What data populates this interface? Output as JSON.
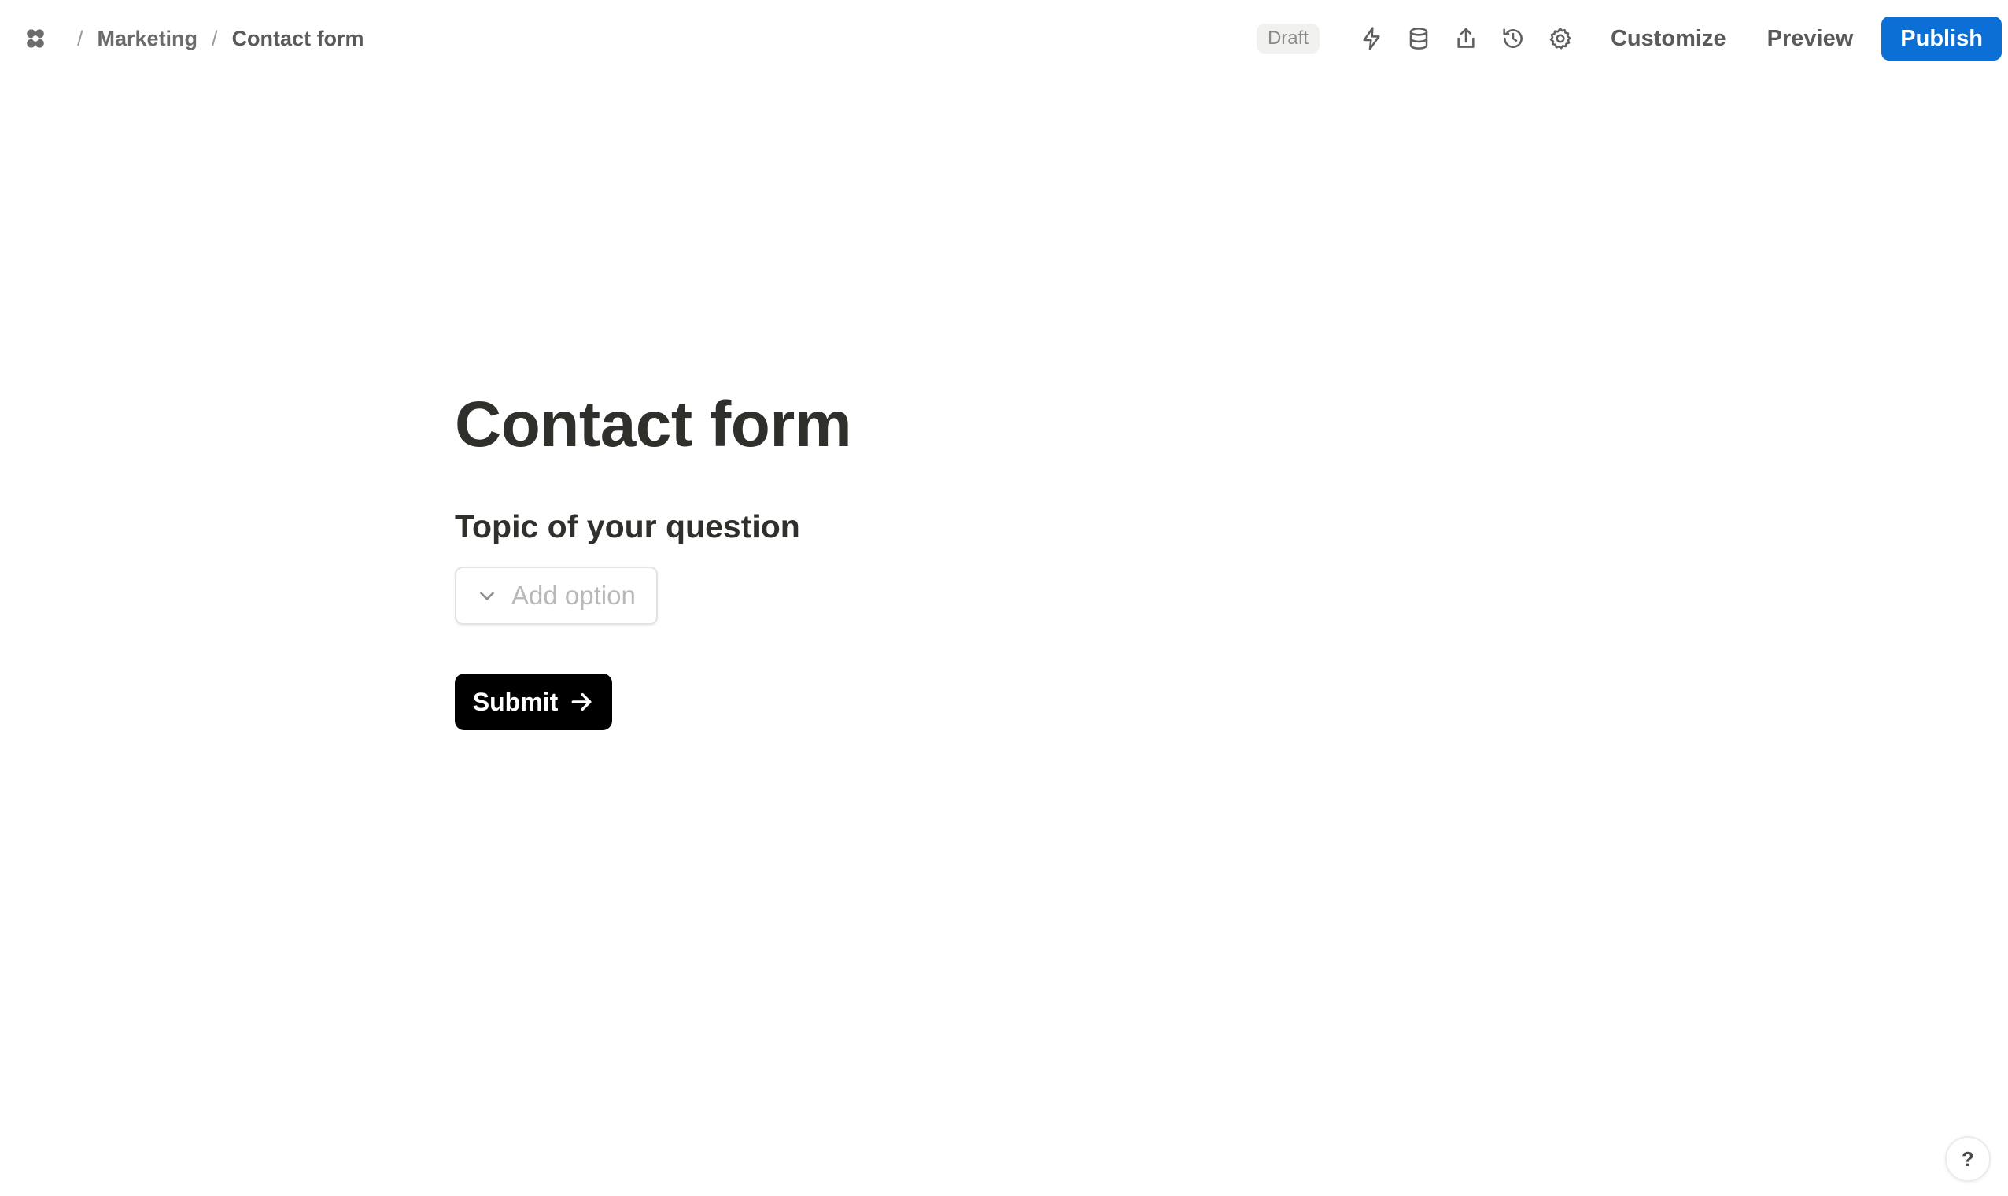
{
  "breadcrumb": {
    "workspace_icon": "workspace-logo-icon",
    "items": [
      {
        "label": "Marketing"
      },
      {
        "label": "Contact form"
      }
    ],
    "separator": "/"
  },
  "toolbar": {
    "status_badge": "Draft",
    "icons": [
      "automation-bolt-icon",
      "database-icon",
      "share-icon",
      "history-icon",
      "settings-gear-icon"
    ],
    "customize_label": "Customize",
    "preview_label": "Preview",
    "publish_label": "Publish",
    "publish_color": "#0b6fd6"
  },
  "form": {
    "title": "Contact form",
    "question": "Topic of your question",
    "select_placeholder": "Add option",
    "submit_label": "Submit"
  },
  "help": {
    "label": "?"
  }
}
